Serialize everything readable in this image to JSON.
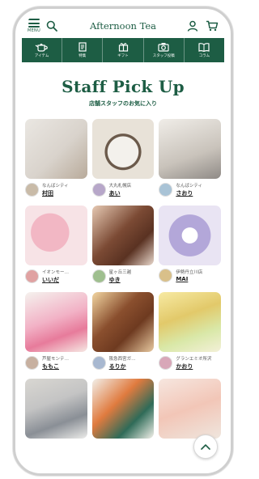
{
  "header": {
    "logo": "Afternoon Tea",
    "menu_label": "MENU"
  },
  "nav": [
    {
      "label": "アイテム",
      "icon": "teapot-icon"
    },
    {
      "label": "特集",
      "icon": "document-icon"
    },
    {
      "label": "ギフト",
      "icon": "gift-icon"
    },
    {
      "label": "スタッフ投稿",
      "icon": "camera-icon"
    },
    {
      "label": "コラム",
      "icon": "book-icon"
    }
  ],
  "title": "Staff Pick Up",
  "subtitle": "店舗スタッフのお気に入り",
  "cards": [
    {
      "shop": "なんばシティ",
      "staff": "村田"
    },
    {
      "shop": "大丸札幌店",
      "staff": "あい"
    },
    {
      "shop": "なんばシティ",
      "staff": "さおり"
    },
    {
      "shop": "イオンモー…",
      "staff": "いいだ"
    },
    {
      "shop": "星ヶ丘三越",
      "staff": "ゆき"
    },
    {
      "shop": "伊勢丹立川店",
      "staff": "MAI"
    },
    {
      "shop": "芦屋モンテ…",
      "staff": "ももこ"
    },
    {
      "shop": "阪急西宮ガ…",
      "staff": "るりか"
    },
    {
      "shop": "グランエミオ所沢",
      "staff": "かおり"
    },
    {
      "shop": "",
      "staff": ""
    },
    {
      "shop": "",
      "staff": ""
    },
    {
      "shop": "",
      "staff": ""
    }
  ],
  "colors": {
    "brand_green": "#1d5d44"
  }
}
